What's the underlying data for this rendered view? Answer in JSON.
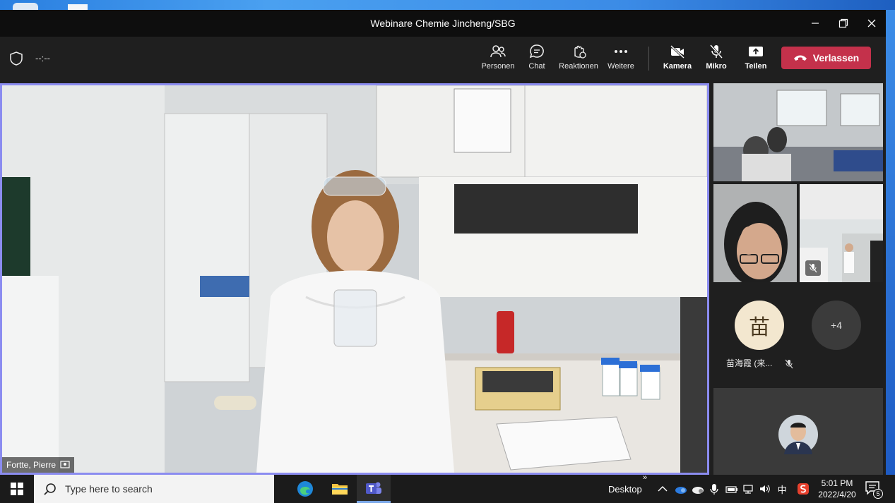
{
  "window": {
    "title": "Webinare Chemie Jincheng/SBG"
  },
  "toolbar": {
    "timer": "--:--",
    "people": "Personen",
    "chat": "Chat",
    "reactions": "Reaktionen",
    "more": "Weitere",
    "camera": "Kamera",
    "mic": "Mikro",
    "share": "Teilen",
    "leave": "Verlassen"
  },
  "main": {
    "speaker_name": "Fortte, Pierre"
  },
  "participants": {
    "avatar_initial": "苗",
    "avatar_name": "苗海霞 (来...",
    "overflow": "+4"
  },
  "taskbar": {
    "search_placeholder": "Type here to search",
    "desktop_label": "Desktop",
    "ime": "中",
    "time": "5:01 PM",
    "date": "2022/4/20",
    "notifications": "5"
  },
  "colors": {
    "leave": "#c4314b",
    "active_speaker_border": "#8b8cf0",
    "accent": "#7aa7e8"
  }
}
